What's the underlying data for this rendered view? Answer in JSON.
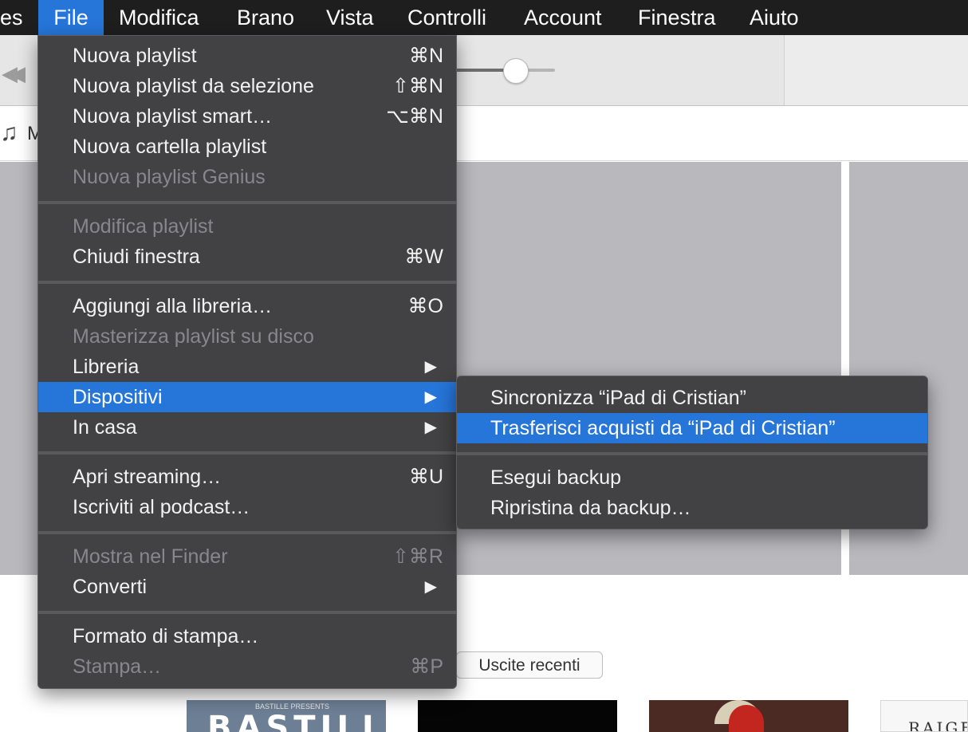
{
  "menubar": {
    "items": [
      {
        "label": "es"
      },
      {
        "label": "File"
      },
      {
        "label": "Modifica"
      },
      {
        "label": "Brano"
      },
      {
        "label": "Vista"
      },
      {
        "label": "Controlli"
      },
      {
        "label": "Account"
      },
      {
        "label": "Finestra"
      },
      {
        "label": "Aiuto"
      }
    ],
    "active_item": "File"
  },
  "nav": {
    "partial_label": "M"
  },
  "file_menu": {
    "items": [
      {
        "label": "Nuova playlist",
        "shortcut": "⌘N",
        "enabled": true
      },
      {
        "label": "Nuova playlist da selezione",
        "shortcut": "⇧⌘N",
        "enabled": true
      },
      {
        "label": "Nuova playlist smart…",
        "shortcut": "⌥⌘N",
        "enabled": true
      },
      {
        "label": "Nuova cartella playlist",
        "shortcut": "",
        "enabled": true
      },
      {
        "label": "Nuova playlist Genius",
        "shortcut": "",
        "enabled": false
      },
      {
        "label": "Modifica playlist",
        "shortcut": "",
        "enabled": false
      },
      {
        "label": "Chiudi finestra",
        "shortcut": "⌘W",
        "enabled": true
      },
      {
        "label": "Aggiungi alla libreria…",
        "shortcut": "⌘O",
        "enabled": true
      },
      {
        "label": "Masterizza playlist su disco",
        "shortcut": "",
        "enabled": false
      },
      {
        "label": "Libreria",
        "shortcut": "",
        "submenu": true,
        "enabled": true
      },
      {
        "label": "Dispositivi",
        "shortcut": "",
        "submenu": true,
        "enabled": true,
        "highlighted": true
      },
      {
        "label": "In casa",
        "shortcut": "",
        "submenu": true,
        "enabled": true
      },
      {
        "label": "Apri streaming…",
        "shortcut": "⌘U",
        "enabled": true
      },
      {
        "label": "Iscriviti al podcast…",
        "shortcut": "",
        "enabled": true
      },
      {
        "label": "Mostra nel Finder",
        "shortcut": "⇧⌘R",
        "enabled": false
      },
      {
        "label": "Converti",
        "shortcut": "",
        "submenu": true,
        "enabled": true
      },
      {
        "label": "Formato di stampa…",
        "shortcut": "",
        "enabled": true
      },
      {
        "label": "Stampa…",
        "shortcut": "⌘P",
        "enabled": false
      }
    ],
    "submenu_arrow": "▶"
  },
  "devices_submenu": {
    "items": [
      {
        "label": "Sincronizza “iPad di Cristian”",
        "enabled": true
      },
      {
        "label": "Trasferisci acquisti da “iPad di Cristian”",
        "enabled": true,
        "highlighted": true
      },
      {
        "label": "Esegui backup",
        "enabled": true
      },
      {
        "label": "Ripristina da backup…",
        "enabled": true
      }
    ]
  },
  "content": {
    "recent_releases_button": "Uscite recenti",
    "albums": [
      {
        "title": "BASTILLE",
        "subtitle": "BASTILLE PRESENTS"
      },
      {
        "title": ""
      },
      {
        "title": ""
      },
      {
        "title": "RAIGE"
      }
    ]
  },
  "icons": {
    "rewind": "rewind-icon",
    "music_note": "music-note-icon",
    "submenu_arrow": "submenu-arrow-icon"
  },
  "colors": {
    "menu_background": "#424244",
    "highlight": "#2675d9",
    "menubar": "#1e1e1e",
    "disabled_text": "#88888c"
  }
}
